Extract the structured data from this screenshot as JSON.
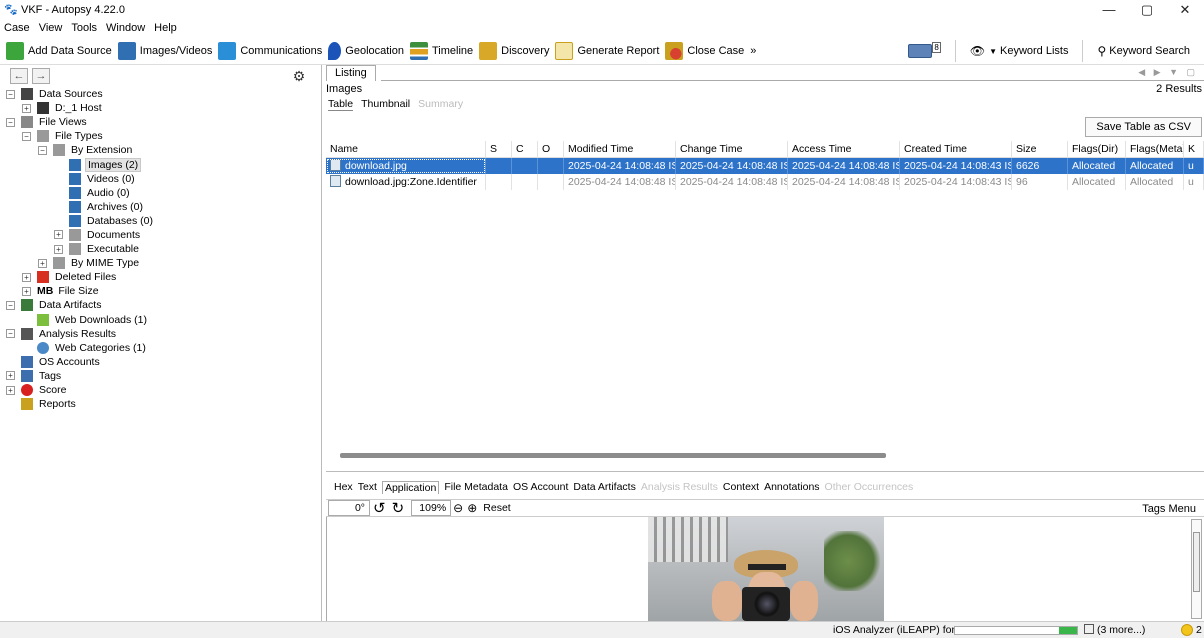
{
  "window": {
    "title": "VKF - Autopsy 4.22.0",
    "controls": {
      "minimize": "—",
      "maximize": "▢",
      "close": "✕"
    }
  },
  "menu": [
    "Case",
    "View",
    "Tools",
    "Window",
    "Help"
  ],
  "toolbar": {
    "items": [
      {
        "label": "Add Data Source",
        "icon": "add-data-source-icon",
        "color": "#3ca53c"
      },
      {
        "label": "Images/Videos",
        "icon": "images-videos-icon",
        "color": "#2f6fb2"
      },
      {
        "label": "Communications",
        "icon": "communications-icon",
        "color": "#2a8fd6"
      },
      {
        "label": "Geolocation",
        "icon": "geolocation-icon",
        "color": "#1b53b8"
      },
      {
        "label": "Timeline",
        "icon": "timeline-icon",
        "color": "#3d8e3d"
      },
      {
        "label": "Discovery",
        "icon": "discovery-icon",
        "color": "#d8a829"
      },
      {
        "label": "Generate Report",
        "icon": "generate-report-icon",
        "color": "#c9a11e"
      },
      {
        "label": "Close Case",
        "icon": "close-case-icon",
        "color": "#d84030"
      }
    ],
    "overflow": "»",
    "keyword_lists": "Keyword Lists",
    "keyword_search": "Keyword Search",
    "mail_badge": "8"
  },
  "nav": {
    "back": "←",
    "forward": "→",
    "tree": [
      {
        "label": "Data Sources",
        "level": 0,
        "exp": "−",
        "icon": "data-sources-icon"
      },
      {
        "label": "D:_1 Host",
        "level": 1,
        "exp": "+",
        "icon": "host-icon"
      },
      {
        "label": "File Views",
        "level": 0,
        "exp": "−",
        "icon": "file-views-icon"
      },
      {
        "label": "File Types",
        "level": 1,
        "exp": "−",
        "icon": "file-types-icon"
      },
      {
        "label": "By Extension",
        "level": 2,
        "exp": "−",
        "icon": "by-extension-icon"
      },
      {
        "label": "Images (2)",
        "level": 3,
        "exp": "",
        "icon": "images-icon",
        "selected": true
      },
      {
        "label": "Videos (0)",
        "level": 3,
        "exp": "",
        "icon": "videos-icon"
      },
      {
        "label": "Audio (0)",
        "level": 3,
        "exp": "",
        "icon": "audio-icon"
      },
      {
        "label": "Archives (0)",
        "level": 3,
        "exp": "",
        "icon": "archives-icon"
      },
      {
        "label": "Databases (0)",
        "level": 3,
        "exp": "",
        "icon": "databases-icon"
      },
      {
        "label": "Documents",
        "level": 3,
        "exp": "+",
        "icon": "documents-icon"
      },
      {
        "label": "Executable",
        "level": 3,
        "exp": "+",
        "icon": "executable-icon"
      },
      {
        "label": "By MIME Type",
        "level": 2,
        "exp": "+",
        "icon": "mime-type-icon"
      },
      {
        "label": "Deleted Files",
        "level": 1,
        "exp": "+",
        "icon": "deleted-files-icon"
      },
      {
        "label": "File Size",
        "level": 1,
        "exp": "+",
        "icon": "file-size-icon",
        "prefix": "MB"
      },
      {
        "label": "Data Artifacts",
        "level": 0,
        "exp": "−",
        "icon": "data-artifacts-icon"
      },
      {
        "label": "Web Downloads (1)",
        "level": 1,
        "exp": "",
        "icon": "web-downloads-icon"
      },
      {
        "label": "Analysis Results",
        "level": 0,
        "exp": "−",
        "icon": "analysis-results-icon"
      },
      {
        "label": "Web Categories (1)",
        "level": 1,
        "exp": "",
        "icon": "web-categories-icon"
      },
      {
        "label": "OS Accounts",
        "level": 0,
        "exp": "",
        "icon": "os-accounts-icon"
      },
      {
        "label": "Tags",
        "level": 0,
        "exp": "+",
        "icon": "tags-icon"
      },
      {
        "label": "Score",
        "level": 0,
        "exp": "+",
        "icon": "score-icon"
      },
      {
        "label": "Reports",
        "level": 0,
        "exp": "",
        "icon": "reports-icon"
      }
    ]
  },
  "listing": {
    "tab": "Listing",
    "heading": "Images",
    "results": "2 Results",
    "subtabs": {
      "table": "Table",
      "thumbnail": "Thumbnail",
      "summary": "Summary"
    },
    "save_csv": "Save Table as CSV",
    "columns": [
      "Name",
      "S",
      "C",
      "O",
      "Modified Time",
      "Change Time",
      "Access Time",
      "Created Time",
      "Size",
      "Flags(Dir)",
      "Flags(Meta)",
      "K"
    ],
    "rows": [
      [
        "download.jpg",
        "",
        "",
        "",
        "2025-04-24 14:08:48 IST",
        "2025-04-24 14:08:48 IST",
        "2025-04-24 14:08:48 IST",
        "2025-04-24 14:08:43 IST",
        "6626",
        "Allocated",
        "Allocated",
        "u"
      ],
      [
        "download.jpg:Zone.Identifier",
        "",
        "",
        "",
        "2025-04-24 14:08:48 IST",
        "2025-04-24 14:08:48 IST",
        "2025-04-24 14:08:48 IST",
        "2025-04-24 14:08:43 IST",
        "96",
        "Allocated",
        "Allocated",
        "u"
      ]
    ]
  },
  "content": {
    "tabs": [
      {
        "label": "Hex",
        "state": "normal"
      },
      {
        "label": "Text",
        "state": "normal"
      },
      {
        "label": "Application",
        "state": "active"
      },
      {
        "label": "File Metadata",
        "state": "normal"
      },
      {
        "label": "OS Account",
        "state": "normal"
      },
      {
        "label": "Data Artifacts",
        "state": "normal"
      },
      {
        "label": "Analysis Results",
        "state": "disabled"
      },
      {
        "label": "Context",
        "state": "normal"
      },
      {
        "label": "Annotations",
        "state": "normal"
      },
      {
        "label": "Other Occurrences",
        "state": "disabled"
      }
    ],
    "rotation": "0°",
    "zoom": "109%",
    "reset": "Reset",
    "tags_menu": "Tags Menu"
  },
  "status": {
    "text": "iOS Analyzer (iLEAPP) for D:",
    "progress": 0.15,
    "more": "(3 more...)",
    "count": "2"
  }
}
